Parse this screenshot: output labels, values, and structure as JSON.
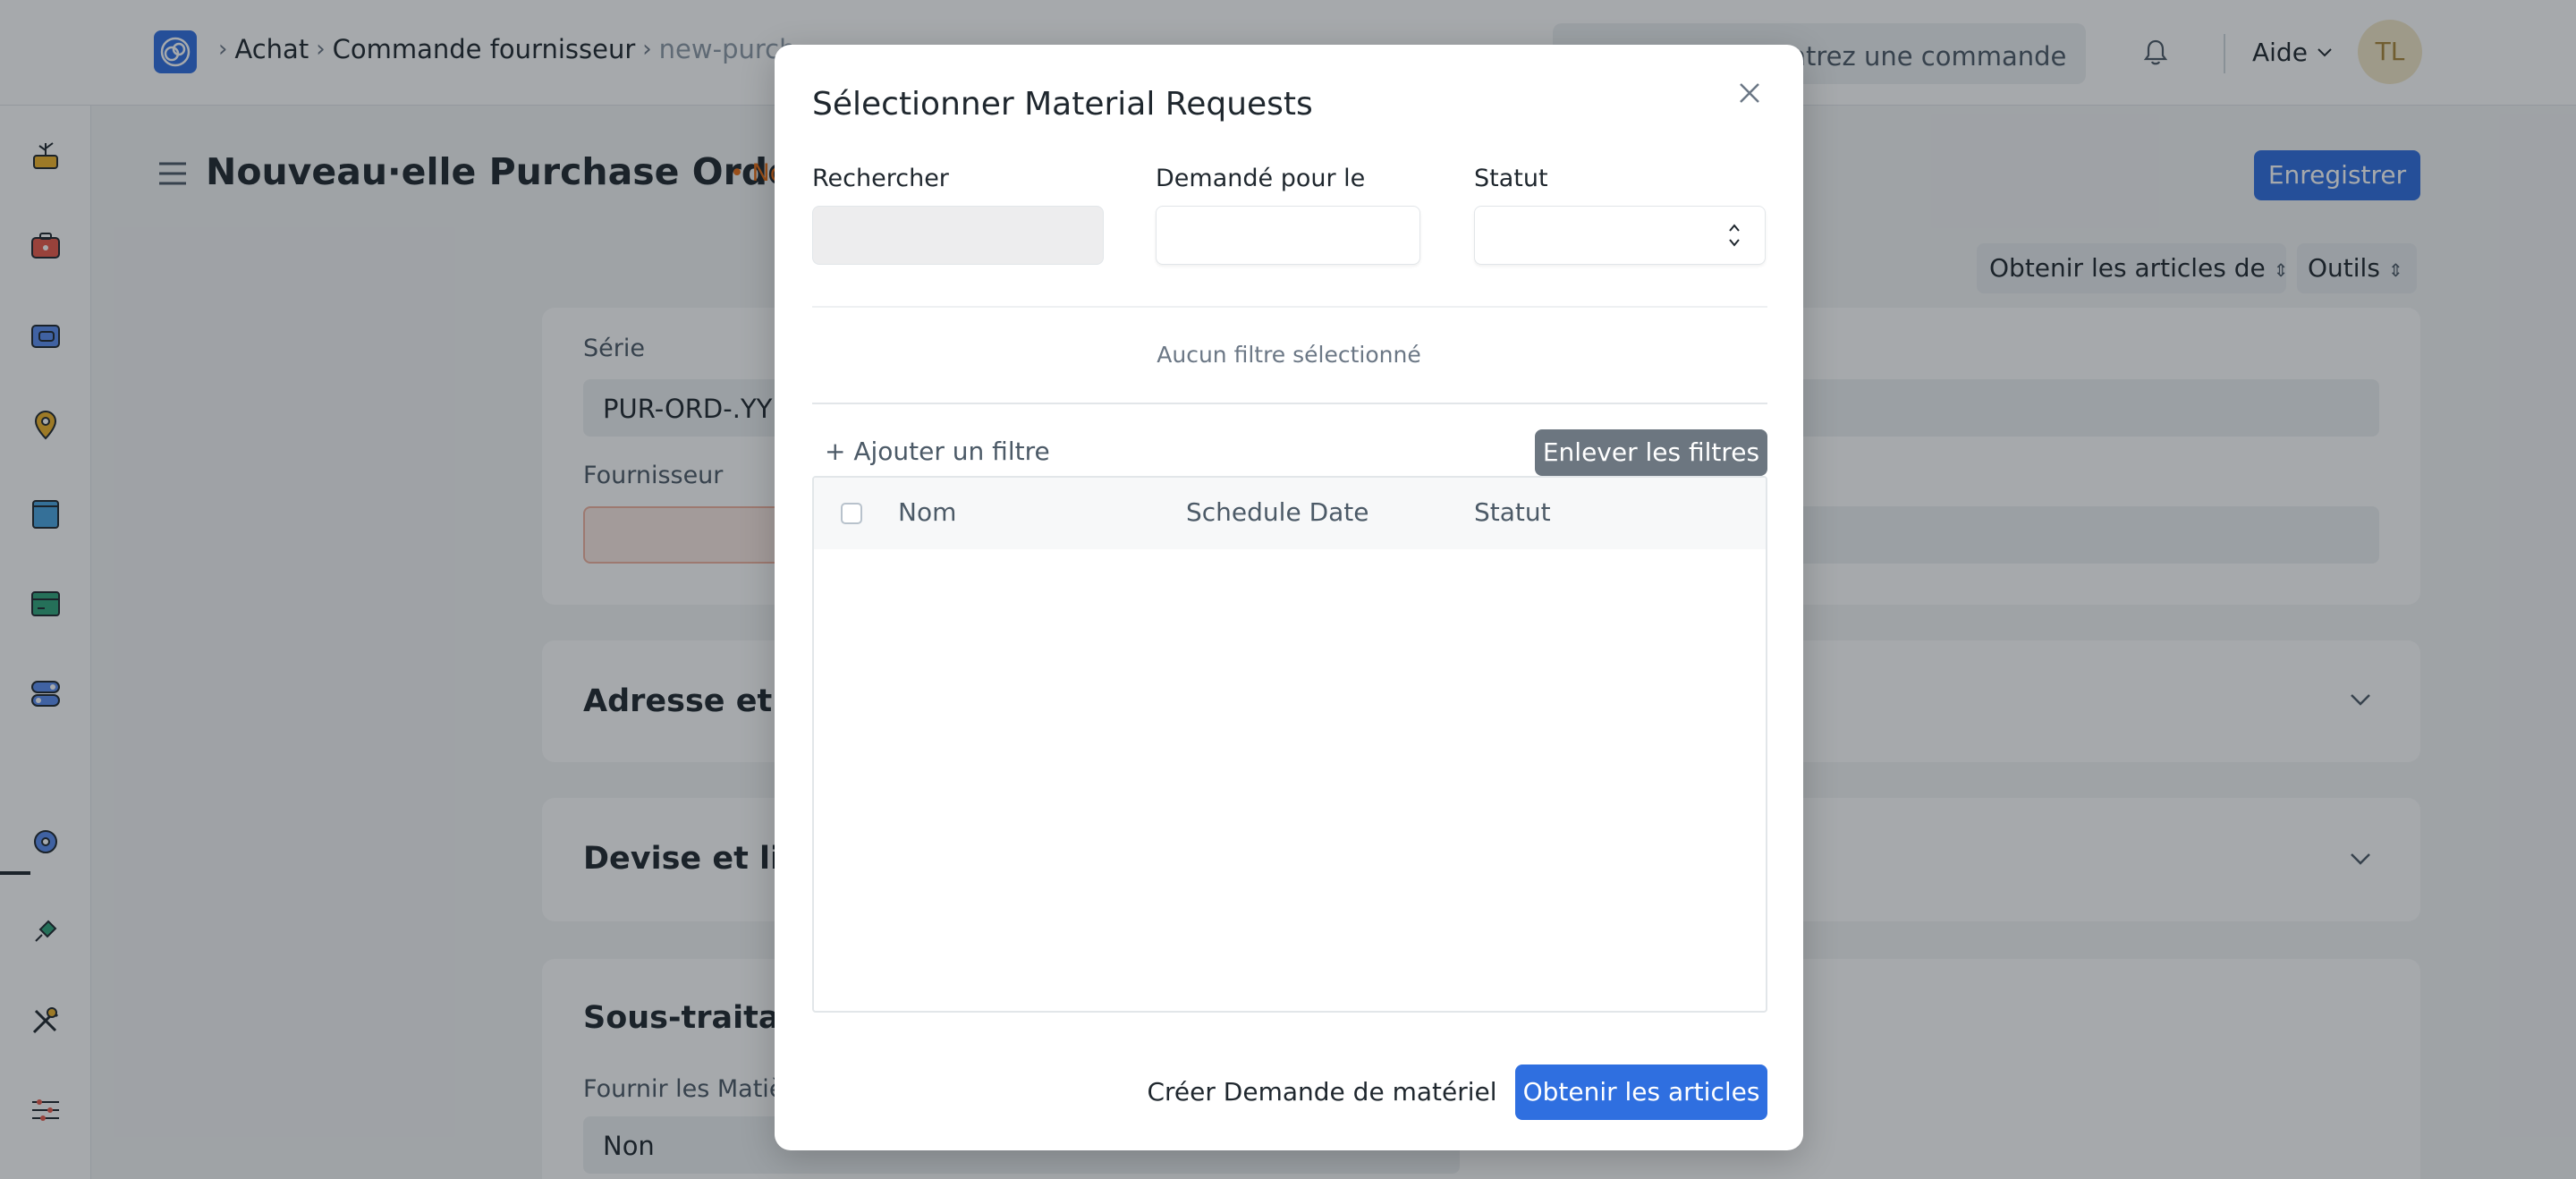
{
  "navbar": {
    "breadcrumbs": [
      "Achat",
      "Commande fournisseur",
      "new-purch"
    ],
    "search_placeholder": "Rechercher ou entrez une commande",
    "help_label": "Aide",
    "avatar_initials": "TL"
  },
  "page": {
    "title": "Nouveau·elle Purchase Order",
    "status": "• No",
    "save_label": "Enregistrer",
    "get_items_label": "Obtenir les articles de",
    "tools_label": "Outils"
  },
  "form": {
    "series_label": "Série",
    "series_value": "PUR-ORD-.YY",
    "supplier_label": "Fournisseur",
    "section_address": "Adresse et Co",
    "section_currency": "Devise et liste",
    "section_subcontract": "Sous-traitanc",
    "supply_label": "Fournir les Matièr",
    "supply_value": "Non"
  },
  "modal": {
    "title": "Sélectionner Material Requests",
    "search_label": "Rechercher",
    "date_label": "Demandé pour le",
    "status_label": "Statut",
    "no_filter_text": "Aucun filtre sélectionné",
    "add_filter_label": "+ Ajouter un filtre",
    "clear_filters_label": "Enlever les filtres",
    "columns": [
      "Nom",
      "Schedule Date",
      "Statut"
    ],
    "create_request_label": "Créer Demande de matériel",
    "get_items_label": "Obtenir les articles"
  }
}
